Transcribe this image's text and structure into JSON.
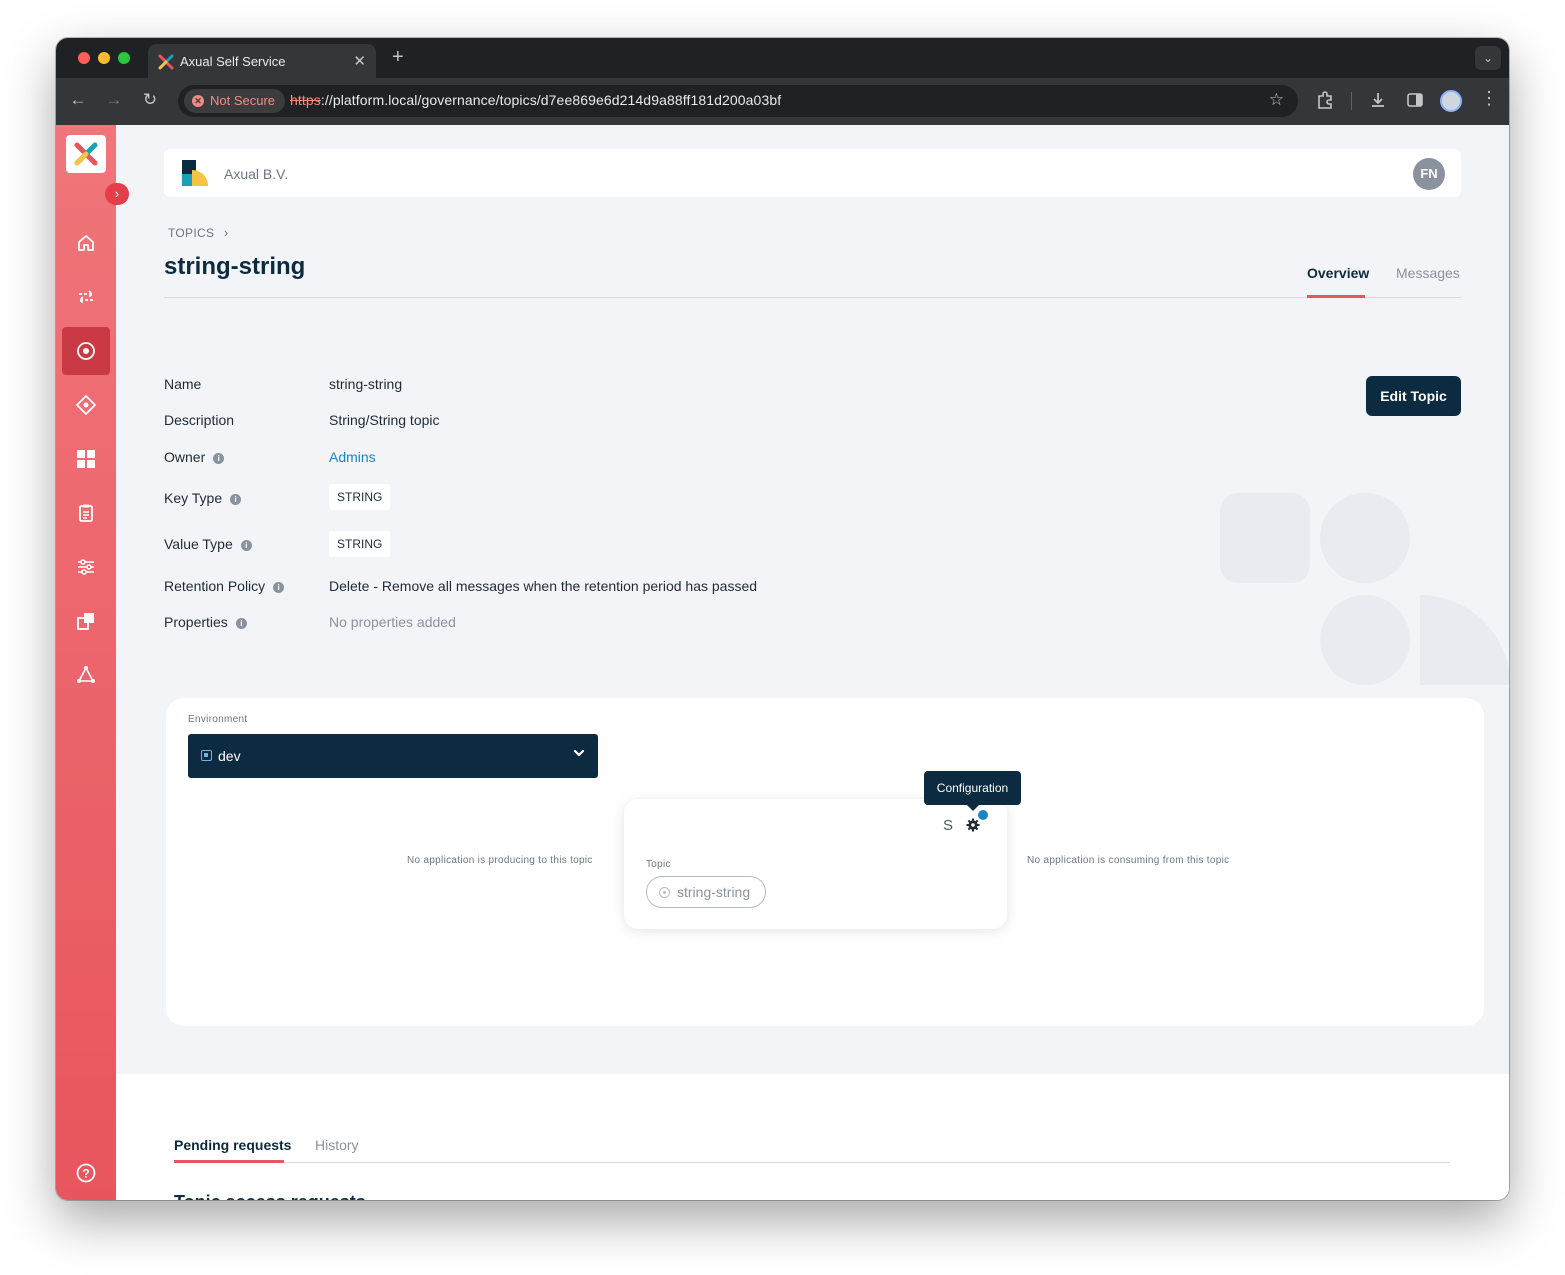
{
  "browser": {
    "tab_title": "Axual Self Service",
    "tab_close": "✕",
    "new_tab": "+",
    "not_secure": "Not Secure",
    "url_scheme": "https",
    "url_rest": "://platform.local/governance/topics/d7ee869e6d214d9a88ff181d200a03bf"
  },
  "header": {
    "org_name": "Axual B.V.",
    "avatar_initials": "FN"
  },
  "breadcrumb": "TOPICS",
  "page_title": "string-string",
  "tabs": {
    "overview": "Overview",
    "messages": "Messages"
  },
  "properties": {
    "name_label": "Name",
    "name_value": "string-string",
    "description_label": "Description",
    "description_value": "String/String topic",
    "owner_label": "Owner",
    "owner_value": "Admins",
    "key_type_label": "Key Type",
    "key_type_value": "STRING",
    "value_type_label": "Value Type",
    "value_type_value": "STRING",
    "retention_label": "Retention Policy",
    "retention_value": "Delete - Remove all messages when the retention period has passed",
    "properties_label": "Properties",
    "properties_value": "No properties added"
  },
  "edit_button": "Edit Topic",
  "environment": {
    "label": "Environment",
    "selected": "dev"
  },
  "flow": {
    "producers_empty": "No application is producing to this topic",
    "consumers_empty": "No application is consuming from this topic",
    "topic_label": "Topic",
    "topic_name": "string-string",
    "schema_icon_text": "S",
    "tooltip": "Configuration"
  },
  "requests": {
    "tab_pending": "Pending requests",
    "tab_history": "History",
    "heading": "Topic access requests"
  },
  "colors": {
    "sidebar": "#e8555e",
    "primary_dark": "#0d2b40",
    "accent_red": "#e8555e",
    "link_blue": "#1a84c7"
  }
}
